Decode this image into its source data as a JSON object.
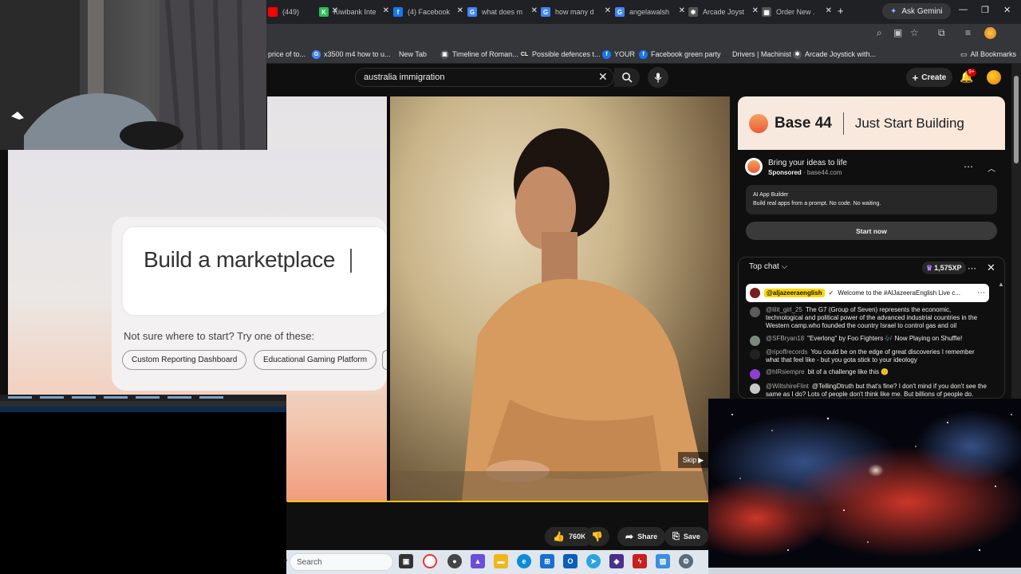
{
  "browser": {
    "tabs": [
      {
        "label": "(449)",
        "fav": "youtube",
        "color": "#ff0000"
      },
      {
        "label": "Kiwibank Inte",
        "fav": "K",
        "color": "#2ebd59"
      },
      {
        "label": "(4) Facebook",
        "fav": "f",
        "color": "#1877f2"
      },
      {
        "label": "what does m",
        "fav": "G",
        "color": "#4285f4"
      },
      {
        "label": "how many d",
        "fav": "G",
        "color": "#4285f4"
      },
      {
        "label": "angelawalsh",
        "fav": "G",
        "color": "#4285f4"
      },
      {
        "label": "Arcade Joyst",
        "fav": "✱",
        "color": "#555"
      },
      {
        "label": "Order New .",
        "fav": "▦",
        "color": "#555"
      }
    ],
    "new_tab": "+",
    "gemini_label": "Ask Gemini",
    "bookmarks": [
      {
        "label": "price of to...",
        "fav": ""
      },
      {
        "label": "x3500 m4 how to u...",
        "fav": "G"
      },
      {
        "label": "New Tab",
        "fav": ""
      },
      {
        "label": "Timeline of Roman...",
        "fav": "▣"
      },
      {
        "label": "Possible defences t...",
        "fav": "CL"
      },
      {
        "label": "YOUR",
        "fav": "f"
      },
      {
        "label": "Facebook green party",
        "fav": "f"
      },
      {
        "label": "Drivers | Machinist",
        "fav": ""
      },
      {
        "label": "Arcade Joystick with...",
        "fav": "✱"
      }
    ],
    "all_bookmarks": "All Bookmarks"
  },
  "youtube": {
    "search_value": "australia immigration",
    "create_label": "Create",
    "notif_count": "9+",
    "actions": {
      "likes": "760K",
      "share": "Share",
      "save": "Save"
    }
  },
  "video": {
    "builder_text": "Build a marketplace",
    "suggest_text": "Not sure where to start? Try one of these:",
    "chips": [
      "Custom Reporting Dashboard",
      "Educational Gaming Platform"
    ],
    "skip_label": "Skip"
  },
  "ad": {
    "brand": "Base 44",
    "tagline": "Just Start Building",
    "title": "Bring your ideas to life",
    "sponsored": "Sponsored",
    "domain": "base44.com",
    "box_title": "AI App Builder",
    "box_body": "Build real apps from a prompt. No code. No waiting.",
    "cta": "Start now"
  },
  "chat": {
    "header": "Top chat",
    "xp": "1,575XP",
    "pinned_author": "@aljazeeraenglish",
    "pinned_text": "Welcome to the #AlJazeeraEnglish Live c...",
    "messages": [
      {
        "author": "@lilit_girl_25",
        "text": "The G7 (Group of Seven) represents the economic, technological and political power of the advanced industrial countries in the Western camp.who founded the country Israel to control gas and oil",
        "color": "#5b5b5b"
      },
      {
        "author": "@SFBryan18",
        "text": "\"Everlong\" by Foo Fighters 🎶 Now Playing on Shuffle!",
        "color": "#7a8a7a"
      },
      {
        "author": "@ripoffrecords",
        "text": "You could be on the edge of great discoveries I remember what that feel like - but you gota stick to your ideology",
        "color": "#222"
      },
      {
        "author": "@hlRsiempre",
        "text": "bit of a challenge like this 🙂",
        "color": "#8b3fd1"
      },
      {
        "author": "@WiltshireFlint",
        "text": "@TellingDtruth but that's fine? I don't mind if you don't see the same as I do? Lots of people don't think like me. But billions of people do.",
        "color": "#c8c8c8"
      }
    ]
  },
  "taskbar": {
    "search_placeholder": "Search"
  }
}
